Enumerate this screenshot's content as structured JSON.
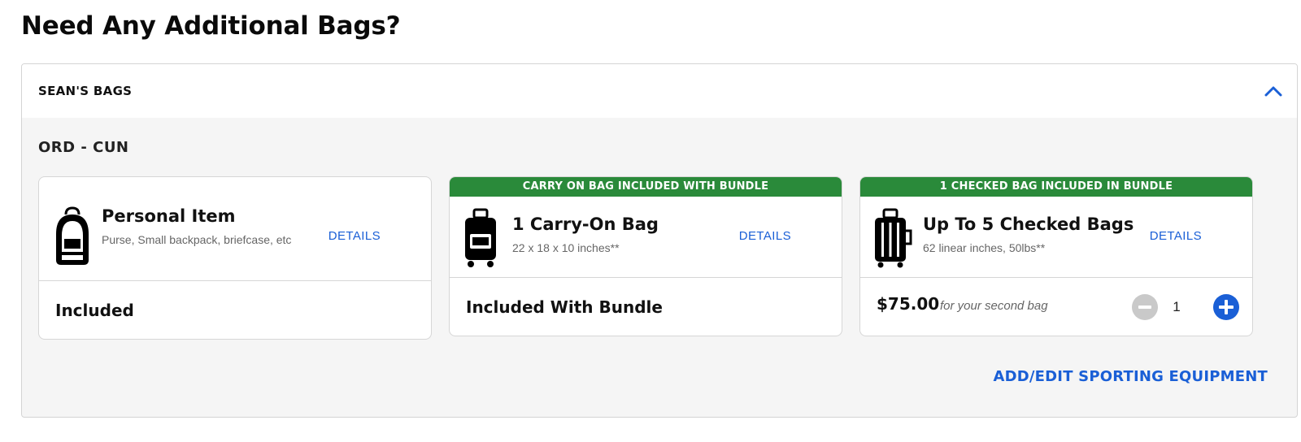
{
  "page": {
    "title": "Need Any Additional Bags?"
  },
  "passenger_panel": {
    "title": "SEAN'S BAGS",
    "collapse_icon": "chevron-up-icon",
    "route": "ORD - CUN",
    "cards": [
      {
        "icon": "backpack-icon",
        "name": "Personal Item",
        "description": "Purse, Small backpack, briefcase, etc",
        "details_label": "DETAILS",
        "status": "Included"
      },
      {
        "banner": "CARRY ON BAG INCLUDED WITH BUNDLE",
        "icon": "carry-on-bag-icon",
        "name": "1 Carry-On Bag",
        "description": "22 x 18 x 10 inches**",
        "details_label": "DETAILS",
        "status": "Included With Bundle"
      },
      {
        "banner": "1 CHECKED BAG INCLUDED IN BUNDLE",
        "icon": "checked-bag-icon",
        "name": "Up To 5 Checked Bags",
        "description": "62 linear inches, 50lbs**",
        "details_label": "DETAILS",
        "price": "$75.00",
        "price_note": "for your second bag",
        "quantity": "1"
      }
    ],
    "sporting_link": "ADD/EDIT SPORTING EQUIPMENT"
  },
  "colors": {
    "accent_blue": "#1a5fd6",
    "banner_green": "#2a8a3a",
    "panel_bg": "#f5f5f5",
    "disabled_gray": "#c9c9c9"
  }
}
